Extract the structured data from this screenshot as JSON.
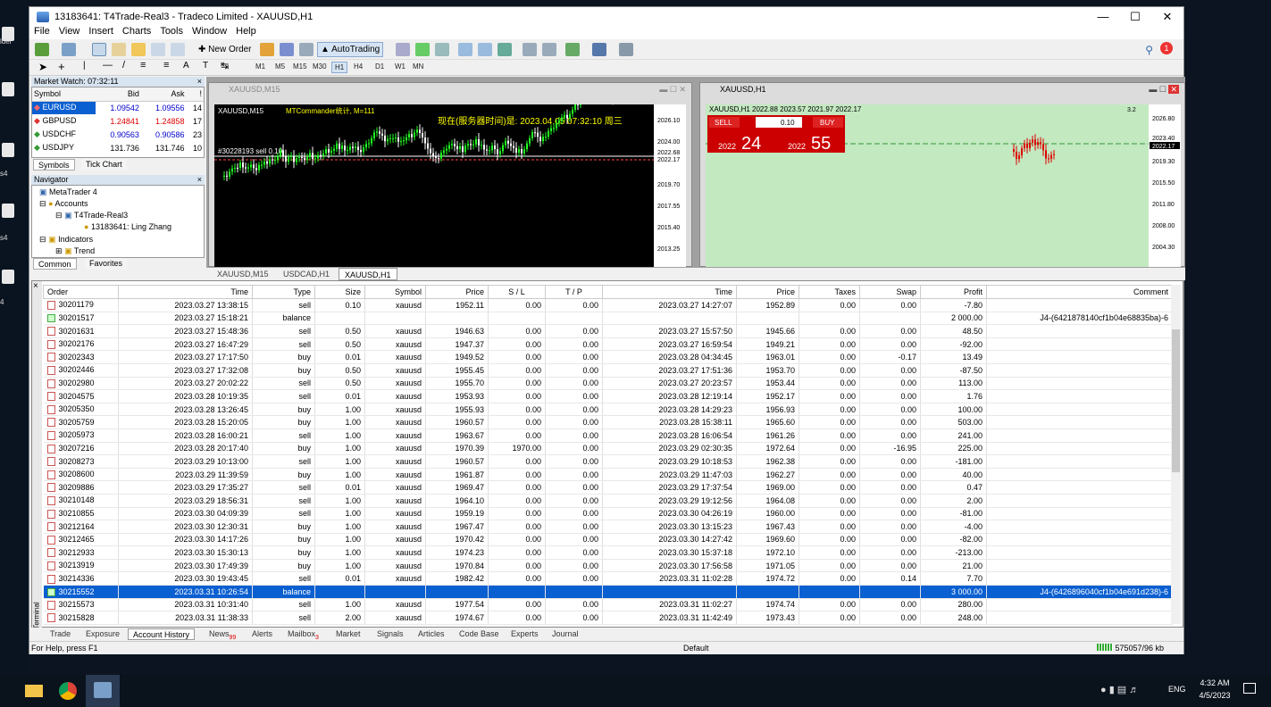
{
  "desktop": {
    "icons": [
      "lder",
      "s4",
      "s4",
      "4"
    ]
  },
  "window": {
    "title": "13183641: T4Trade-Real3 - Tradeco Limited - XAUUSD,H1"
  },
  "menu": [
    "File",
    "View",
    "Insert",
    "Charts",
    "Tools",
    "Window",
    "Help"
  ],
  "toolbar": {
    "new_order": "New Order",
    "autotrading": "AutoTrading",
    "notification_count": "1"
  },
  "timeframes": [
    "M1",
    "M5",
    "M15",
    "M30",
    "H1",
    "H4",
    "D1",
    "W1",
    "MN"
  ],
  "market_watch": {
    "title": "Market Watch: 07:32:11",
    "headers": [
      "Symbol",
      "Bid",
      "Ask",
      "!"
    ],
    "rows": [
      [
        "EURUSD",
        "1.09542",
        "1.09556",
        "14"
      ],
      [
        "GBPUSD",
        "1.24841",
        "1.24858",
        "17"
      ],
      [
        "USDCHF",
        "0.90563",
        "0.90586",
        "23"
      ],
      [
        "USDJPY",
        "131.736",
        "131.746",
        "10"
      ]
    ],
    "tabs": [
      "Symbols",
      "Tick Chart"
    ]
  },
  "navigator": {
    "title": "Navigator",
    "items": [
      "MetaTrader 4",
      "Accounts",
      "T4Trade-Real3",
      "13183641: Ling Zhang",
      "Indicators",
      "Trend"
    ],
    "tabs": [
      "Common",
      "Favorites"
    ]
  },
  "chart1": {
    "title": "XAUUSD,M15",
    "label": "XAUUSD,M15",
    "indicator": "MTCommander统计, M=111",
    "server_time": "现在(服务器时间)是: 2023.04.05 07:32:10 周三",
    "order_label": "#30228193 sell 0.10",
    "prices": [
      "2026.10",
      "2024.00",
      "2022.68",
      "2022.17",
      "2019.70",
      "2017.55",
      "2015.40",
      "2013.25"
    ]
  },
  "chart2": {
    "title": "XAUUSD,H1",
    "ohlc": "XAUUSD,H1  2022.88 2023.57 2021.97 2022.17",
    "sell": "SELL",
    "buy": "BUY",
    "lot": "0.10",
    "bid_pre": "2022",
    "bid_big": "24",
    "ask_pre": "2022",
    "ask_big": "55",
    "zoom": "3.2",
    "prices": [
      "2026.80",
      "2023.40",
      "2022.17",
      "2019.30",
      "2015.50",
      "2011.80",
      "2008.00",
      "2004.30"
    ]
  },
  "chart_tabs": [
    "XAUUSD,M15",
    "USDCAD,H1",
    "XAUUSD,H1"
  ],
  "history": {
    "headers": [
      "Order",
      "Time",
      "Type",
      "Size",
      "Symbol",
      "Price",
      "S / L",
      "T / P",
      "Time",
      "Price",
      "Taxes",
      "Swap",
      "Profit",
      "Comment"
    ],
    "rows": [
      [
        "30201179",
        "2023.03.27 13:38:15",
        "sell",
        "0.10",
        "xauusd",
        "1952.11",
        "0.00",
        "0.00",
        "2023.03.27 14:27:07",
        "1952.89",
        "0.00",
        "0.00",
        "-7.80",
        ""
      ],
      [
        "30201517",
        "2023.03.27 15:18:21",
        "balance",
        "",
        "",
        "",
        "",
        "",
        "",
        "",
        "",
        "",
        "2 000.00",
        "J4-(6421878140cf1b04e68835ba)-6"
      ],
      [
        "30201631",
        "2023.03.27 15:48:36",
        "sell",
        "0.50",
        "xauusd",
        "1946.63",
        "0.00",
        "0.00",
        "2023.03.27 15:57:50",
        "1945.66",
        "0.00",
        "0.00",
        "48.50",
        ""
      ],
      [
        "30202176",
        "2023.03.27 16:47:29",
        "sell",
        "0.50",
        "xauusd",
        "1947.37",
        "0.00",
        "0.00",
        "2023.03.27 16:59:54",
        "1949.21",
        "0.00",
        "0.00",
        "-92.00",
        ""
      ],
      [
        "30202343",
        "2023.03.27 17:17:50",
        "buy",
        "0.01",
        "xauusd",
        "1949.52",
        "0.00",
        "0.00",
        "2023.03.28 04:34:45",
        "1963.01",
        "0.00",
        "-0.17",
        "13.49",
        ""
      ],
      [
        "30202446",
        "2023.03.27 17:32:08",
        "buy",
        "0.50",
        "xauusd",
        "1955.45",
        "0.00",
        "0.00",
        "2023.03.27 17:51:36",
        "1953.70",
        "0.00",
        "0.00",
        "-87.50",
        ""
      ],
      [
        "30202980",
        "2023.03.27 20:02:22",
        "sell",
        "0.50",
        "xauusd",
        "1955.70",
        "0.00",
        "0.00",
        "2023.03.27 20:23:57",
        "1953.44",
        "0.00",
        "0.00",
        "113.00",
        ""
      ],
      [
        "30204575",
        "2023.03.28 10:19:35",
        "sell",
        "0.01",
        "xauusd",
        "1953.93",
        "0.00",
        "0.00",
        "2023.03.28 12:19:14",
        "1952.17",
        "0.00",
        "0.00",
        "1.76",
        ""
      ],
      [
        "30205350",
        "2023.03.28 13:26:45",
        "buy",
        "1.00",
        "xauusd",
        "1955.93",
        "0.00",
        "0.00",
        "2023.03.28 14:29:23",
        "1956.93",
        "0.00",
        "0.00",
        "100.00",
        ""
      ],
      [
        "30205759",
        "2023.03.28 15:20:05",
        "buy",
        "1.00",
        "xauusd",
        "1960.57",
        "0.00",
        "0.00",
        "2023.03.28 15:38:11",
        "1965.60",
        "0.00",
        "0.00",
        "503.00",
        ""
      ],
      [
        "30205973",
        "2023.03.28 16:00:21",
        "sell",
        "1.00",
        "xauusd",
        "1963.67",
        "0.00",
        "0.00",
        "2023.03.28 16:06:54",
        "1961.26",
        "0.00",
        "0.00",
        "241.00",
        ""
      ],
      [
        "30207216",
        "2023.03.28 20:17:40",
        "buy",
        "1.00",
        "xauusd",
        "1970.39",
        "1970.00",
        "0.00",
        "2023.03.29 02:30:35",
        "1972.64",
        "0.00",
        "-16.95",
        "225.00",
        ""
      ],
      [
        "30208273",
        "2023.03.29 10:13:00",
        "sell",
        "1.00",
        "xauusd",
        "1960.57",
        "0.00",
        "0.00",
        "2023.03.29 10:18:53",
        "1962.38",
        "0.00",
        "0.00",
        "-181.00",
        ""
      ],
      [
        "30208600",
        "2023.03.29 11:39:59",
        "buy",
        "1.00",
        "xauusd",
        "1961.87",
        "0.00",
        "0.00",
        "2023.03.29 11:47:03",
        "1962.27",
        "0.00",
        "0.00",
        "40.00",
        ""
      ],
      [
        "30209886",
        "2023.03.29 17:35:27",
        "sell",
        "0.01",
        "xauusd",
        "1969.47",
        "0.00",
        "0.00",
        "2023.03.29 17:37:54",
        "1969.00",
        "0.00",
        "0.00",
        "0.47",
        ""
      ],
      [
        "30210148",
        "2023.03.29 18:56:31",
        "sell",
        "1.00",
        "xauusd",
        "1964.10",
        "0.00",
        "0.00",
        "2023.03.29 19:12:56",
        "1964.08",
        "0.00",
        "0.00",
        "2.00",
        ""
      ],
      [
        "30210855",
        "2023.03.30 04:09:39",
        "sell",
        "1.00",
        "xauusd",
        "1959.19",
        "0.00",
        "0.00",
        "2023.03.30 04:26:19",
        "1960.00",
        "0.00",
        "0.00",
        "-81.00",
        ""
      ],
      [
        "30212164",
        "2023.03.30 12:30:31",
        "buy",
        "1.00",
        "xauusd",
        "1967.47",
        "0.00",
        "0.00",
        "2023.03.30 13:15:23",
        "1967.43",
        "0.00",
        "0.00",
        "-4.00",
        ""
      ],
      [
        "30212465",
        "2023.03.30 14:17:26",
        "buy",
        "1.00",
        "xauusd",
        "1970.42",
        "0.00",
        "0.00",
        "2023.03.30 14:27:42",
        "1969.60",
        "0.00",
        "0.00",
        "-82.00",
        ""
      ],
      [
        "30212933",
        "2023.03.30 15:30:13",
        "buy",
        "1.00",
        "xauusd",
        "1974.23",
        "0.00",
        "0.00",
        "2023.03.30 15:37:18",
        "1972.10",
        "0.00",
        "0.00",
        "-213.00",
        ""
      ],
      [
        "30213919",
        "2023.03.30 17:49:39",
        "buy",
        "1.00",
        "xauusd",
        "1970.84",
        "0.00",
        "0.00",
        "2023.03.30 17:56:58",
        "1971.05",
        "0.00",
        "0.00",
        "21.00",
        ""
      ],
      [
        "30214336",
        "2023.03.30 19:43:45",
        "sell",
        "0.01",
        "xauusd",
        "1982.42",
        "0.00",
        "0.00",
        "2023.03.31 11:02:28",
        "1974.72",
        "0.00",
        "0.14",
        "7.70",
        ""
      ],
      [
        "30215552",
        "2023.03.31 10:26:54",
        "balance",
        "",
        "",
        "",
        "",
        "",
        "",
        "",
        "",
        "",
        "3 000.00",
        "J4-(6426896040cf1b04e691d238)-6"
      ],
      [
        "30215573",
        "2023.03.31 10:31:40",
        "sell",
        "1.00",
        "xauusd",
        "1977.54",
        "0.00",
        "0.00",
        "2023.03.31 11:02:27",
        "1974.74",
        "0.00",
        "0.00",
        "280.00",
        ""
      ],
      [
        "30215828",
        "2023.03.31 11:38:33",
        "sell",
        "2.00",
        "xauusd",
        "1974.67",
        "0.00",
        "0.00",
        "2023.03.31 11:42:49",
        "1973.43",
        "0.00",
        "0.00",
        "248.00",
        ""
      ]
    ],
    "selected_index": 22
  },
  "terminal_tabs": [
    "Trade",
    "Exposure",
    "Account History",
    "News",
    "Alerts",
    "Mailbox",
    "Market",
    "Signals",
    "Articles",
    "Code Base",
    "Experts",
    "Journal"
  ],
  "terminal_tab_badges": {
    "News": "99",
    "Mailbox": "3"
  },
  "terminal_side_label": "Terminal",
  "status": {
    "help": "For Help, press F1",
    "profile": "Default",
    "traffic": "575057/96 kb"
  },
  "taskbar": {
    "time": "4:32 AM",
    "date": "4/5/2023",
    "lang": "ENG"
  }
}
